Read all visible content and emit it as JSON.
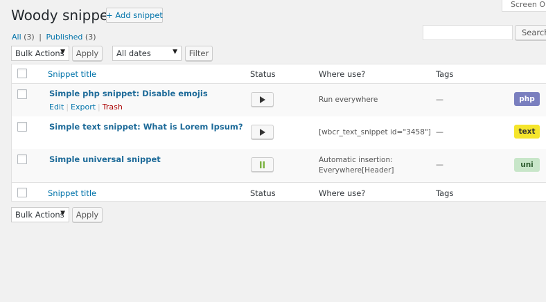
{
  "header": {
    "title": "Woody snippets",
    "add_label": "+ Add snippet",
    "screen_options_label": "Screen Opt"
  },
  "filters": {
    "all_label": "All",
    "all_count": "(3)",
    "separator": "|",
    "published_label": "Published",
    "published_count": "(3)"
  },
  "search": {
    "value": "",
    "button_label": "Search s"
  },
  "toolbar": {
    "bulk_actions": "Bulk Actions",
    "apply": "Apply",
    "dates": "All dates",
    "filter": "Filter"
  },
  "table": {
    "columns": {
      "title": "Snippet title",
      "status": "Status",
      "where": "Where use?",
      "tags": "Tags"
    },
    "rows": [
      {
        "title": "Simple php snippet: Disable emojis",
        "actions": {
          "edit": "Edit",
          "export": "Export",
          "trash": "Trash"
        },
        "status": "play",
        "where_line1": "Run everywhere",
        "where_line2": "",
        "tags": "—",
        "type": "php"
      },
      {
        "title": "Simple text snippet: What is Lorem Ipsum?",
        "status": "play",
        "where_line1": "[wbcr_text_snippet id=\"3458\"]",
        "where_line2": "",
        "tags": "—",
        "type": "text"
      },
      {
        "title": "Simple universal snippet",
        "status": "pause",
        "where_line1": "Automatic insertion:",
        "where_line2": "Everywhere[Header]",
        "tags": "—",
        "type": "uni"
      }
    ]
  },
  "colors": {
    "link": "#0073aa",
    "trash": "#a00000",
    "php_badge": "#7a7fbf",
    "text_badge": "#f5e52c",
    "uni_badge": "#c8e6c9",
    "pause_icon": "#7cb342"
  }
}
